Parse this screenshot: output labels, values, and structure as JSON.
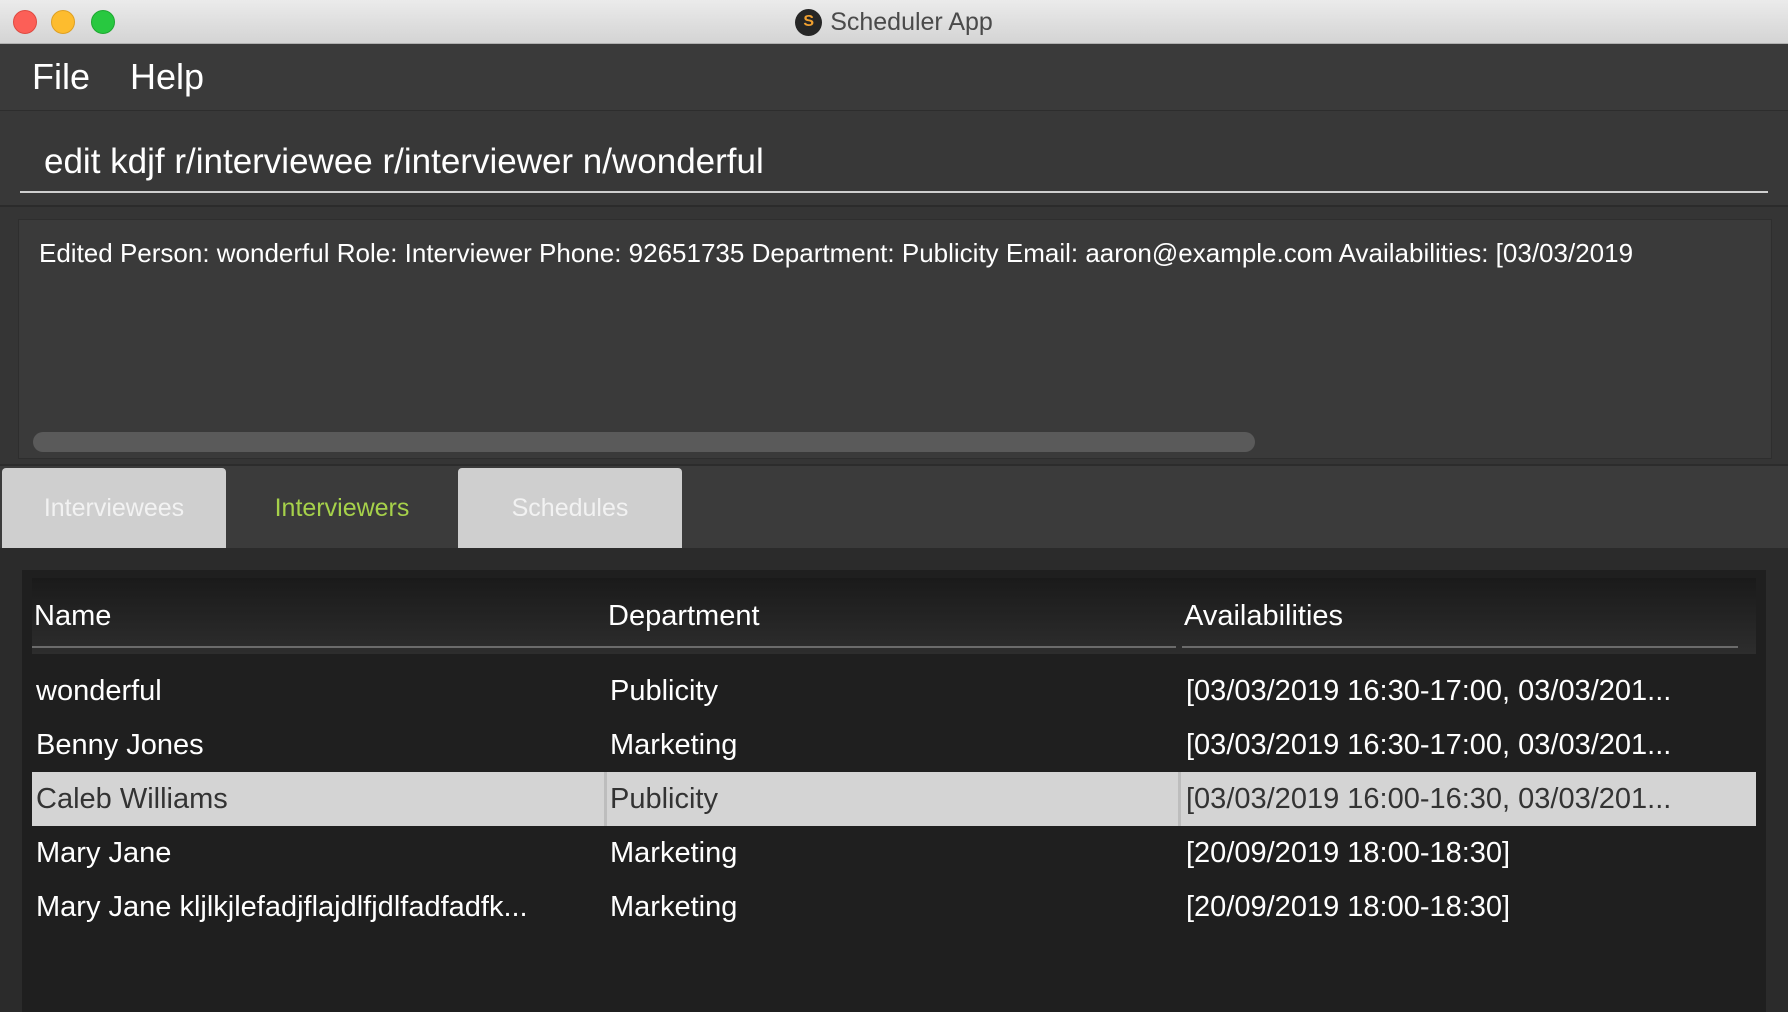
{
  "window": {
    "title": "Scheduler App",
    "app_icon_letter": "S"
  },
  "menu": {
    "file": "File",
    "help": "Help"
  },
  "command": {
    "value": "edit kdjf r/interviewee r/interviewer n/wonderful"
  },
  "result": {
    "text": "Edited Person: wonderful Role: Interviewer Phone: 92651735 Department: Publicity Email: aaron@example.com Availabilities: [03/03/2019"
  },
  "tabs": [
    {
      "label": "Interviewees",
      "active": false
    },
    {
      "label": "Interviewers",
      "active": true
    },
    {
      "label": "Schedules",
      "active": false
    }
  ],
  "table": {
    "columns": [
      "Name",
      "Department",
      "Availabilities"
    ],
    "rows": [
      {
        "name": "wonderful",
        "department": "Publicity",
        "availabilities": "[03/03/2019 16:30-17:00, 03/03/201..."
      },
      {
        "name": "Benny Jones",
        "department": "Marketing",
        "availabilities": "[03/03/2019 16:30-17:00, 03/03/201..."
      },
      {
        "name": "Caleb Williams",
        "department": "Publicity",
        "availabilities": "[03/03/2019 16:00-16:30, 03/03/201...",
        "selected": true
      },
      {
        "name": "Mary Jane",
        "department": "Marketing",
        "availabilities": "[20/09/2019 18:00-18:30]"
      },
      {
        "name": "Mary Jane kljlkjlefadjflajdlfjdlfadfadfk...",
        "department": "Marketing",
        "availabilities": "[20/09/2019 18:00-18:30]"
      }
    ]
  },
  "colors": {
    "active_tab_text": "#a6d14a",
    "selected_row_bg": "#d4d4d4",
    "background": "#3b3b3b"
  }
}
